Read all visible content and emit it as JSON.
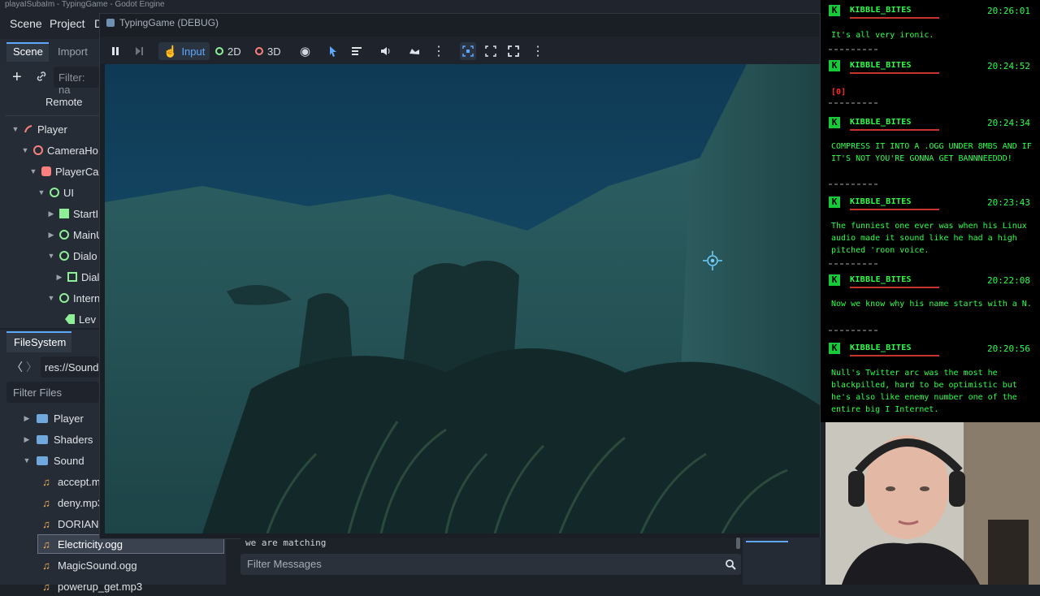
{
  "window": {
    "title": "playaISubaIm",
    "subtitle": "TypingGame - Godot Engine"
  },
  "menu": {
    "scene": "Scene",
    "project": "Project",
    "debug_clip": "D"
  },
  "scene_dock": {
    "tabs": [
      {
        "label": "Scene"
      },
      {
        "label": "Import"
      }
    ],
    "filter_placeholder": "Filter: na",
    "remote_label": "Remote",
    "tree": [
      {
        "label": "Player"
      },
      {
        "label": "CameraHo"
      },
      {
        "label": "PlayerCa"
      },
      {
        "label": "UI"
      },
      {
        "label": "StartI"
      },
      {
        "label": "MainU"
      },
      {
        "label": "Dialo"
      },
      {
        "label": "Dial"
      },
      {
        "label": "Intern"
      },
      {
        "label": "Lev"
      }
    ]
  },
  "filesystem": {
    "title": "FileSystem",
    "path": "res://Sound",
    "filter_label": "Filter Files",
    "items": [
      {
        "label": "Player"
      },
      {
        "label": "Shaders"
      },
      {
        "label": "Sound"
      },
      {
        "label": "accept.m"
      },
      {
        "label": "deny.mp3"
      },
      {
        "label": "DORIAN.("
      },
      {
        "label": "Electricity.ogg"
      },
      {
        "label": "MagicSound.ogg"
      },
      {
        "label": "powerup_get.mp3"
      }
    ]
  },
  "game_window": {
    "title": "TypingGame (DEBUG)",
    "toolbar": {
      "input": "Input",
      "mode_2d": "2D",
      "mode_3d": "3D"
    }
  },
  "output": {
    "last_line": "we are matching",
    "filter_placeholder": "Filter Messages"
  },
  "chat": {
    "messages": [
      {
        "user": "KIBBLE_BITES",
        "time": "20:26:01",
        "text": "It's all very ironic."
      },
      {
        "user": "KIBBLE_BITES",
        "time": "20:24:52",
        "text": "[0]"
      },
      {
        "user": "KIBBLE_BITES",
        "time": "20:24:34",
        "text": "COMPRESS IT INTO A .OGG UNDER 8MBS AND IF IT'S NOT YOU'RE GONNA GET BANNNEEDDD!"
      },
      {
        "user": "KIBBLE_BITES",
        "time": "20:23:43",
        "text": "The funniest one ever was when his Linux audio made it sound like he had a high pitched 'roon voice."
      },
      {
        "user": "KIBBLE_BITES",
        "time": "20:22:08",
        "text": "Now we know why his name starts with a N."
      },
      {
        "user": "KIBBLE_BITES",
        "time": "20:20:56",
        "text": "Null's Twitter arc was the most he blackpilled, hard to be optimistic but he's also like enemy number one of the entire big I Internet."
      }
    ]
  },
  "colors": {
    "accent": "#5fa8ff",
    "chat_green": "#2bff4a",
    "badge_green": "#18c93a",
    "chat_underline": "#c8332e"
  }
}
